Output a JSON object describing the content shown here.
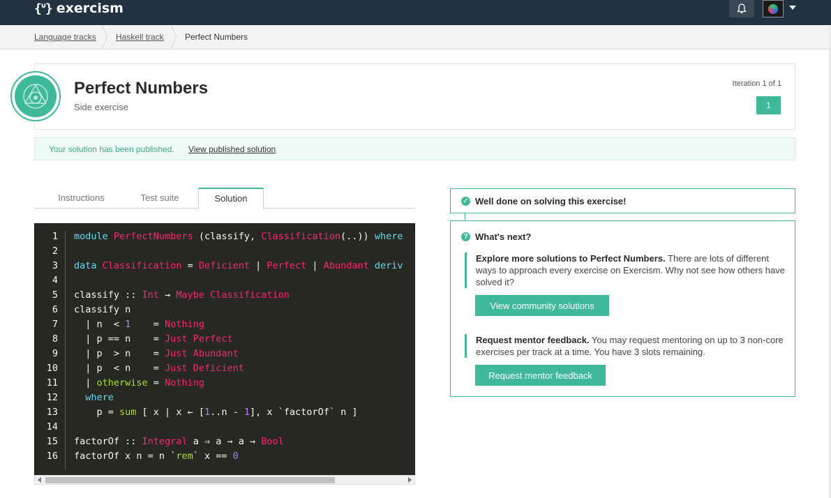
{
  "app": {
    "logo_mark": "{ᐡ}",
    "logo_text": "exercism"
  },
  "breadcrumb": [
    {
      "label": "Language tracks",
      "link": true
    },
    {
      "label": "Haskell track",
      "link": true
    },
    {
      "label": "Perfect Numbers",
      "link": false
    }
  ],
  "exercise": {
    "title": "Perfect Numbers",
    "subtitle": "Side exercise",
    "iteration_label": "Iteration 1 of 1",
    "iteration_button": "1"
  },
  "notice": {
    "text": "Your solution has been published.",
    "link": "View published solution"
  },
  "tabs": [
    {
      "label": "Instructions",
      "active": false
    },
    {
      "label": "Test suite",
      "active": false
    },
    {
      "label": "Solution",
      "active": true
    }
  ],
  "code": {
    "lines": [
      [
        [
          "k",
          "module"
        ],
        [
          "",
          ""
        ],
        [
          "t",
          "PerfectNumbers"
        ],
        [
          "",
          " (classify, "
        ],
        [
          "t",
          "Classification"
        ],
        [
          "",
          "(..)) "
        ],
        [
          "k",
          "where"
        ]
      ],
      [],
      [
        [
          "k",
          "data"
        ],
        [
          "",
          " "
        ],
        [
          "t",
          "Classification"
        ],
        [
          "",
          " = "
        ],
        [
          "t",
          "Deficient"
        ],
        [
          "",
          " | "
        ],
        [
          "t",
          "Perfect"
        ],
        [
          "",
          " | "
        ],
        [
          "t",
          "Abundant"
        ],
        [
          "",
          " "
        ],
        [
          "k",
          "deriv"
        ]
      ],
      [],
      [
        [
          "",
          "classify :: "
        ],
        [
          "t",
          "Int"
        ],
        [
          "",
          " → "
        ],
        [
          "t",
          "Maybe Classification"
        ]
      ],
      [
        [
          "",
          "classify n"
        ]
      ],
      [
        [
          "",
          "  | n  < "
        ],
        [
          "n",
          "1"
        ],
        [
          "",
          "    = "
        ],
        [
          "t",
          "Nothing"
        ]
      ],
      [
        [
          "",
          "  | p == n    = "
        ],
        [
          "t",
          "Just Perfect"
        ]
      ],
      [
        [
          "",
          "  | p  > n    = "
        ],
        [
          "t",
          "Just Abundant"
        ]
      ],
      [
        [
          "",
          "  | p  < n    = "
        ],
        [
          "t",
          "Just Deficient"
        ]
      ],
      [
        [
          "",
          "  | "
        ],
        [
          "g",
          "otherwise"
        ],
        [
          "",
          " = "
        ],
        [
          "t",
          "Nothing"
        ]
      ],
      [
        [
          "k",
          "  where"
        ]
      ],
      [
        [
          "",
          "    p = "
        ],
        [
          "g",
          "sum"
        ],
        [
          "",
          " [ x | x ← ["
        ],
        [
          "n",
          "1"
        ],
        [
          "",
          "..n - "
        ],
        [
          "n",
          "1"
        ],
        [
          "",
          "], x `factorOf` n ]"
        ]
      ],
      [],
      [
        [
          "",
          "factorOf :: "
        ],
        [
          "t",
          "Integral"
        ],
        [
          "",
          " a ⇒ a → a → "
        ],
        [
          "t",
          "Bool"
        ]
      ],
      [
        [
          "",
          "factorOf x n = n `"
        ],
        [
          "g",
          "rem"
        ],
        [
          "",
          "` x == "
        ],
        [
          "n",
          "0"
        ]
      ]
    ],
    "line_numbers": [
      "1",
      "2",
      "3",
      "4",
      "5",
      "6",
      "7",
      "8",
      "9",
      "10",
      "11",
      "12",
      "13",
      "14",
      "15",
      "16"
    ]
  },
  "right_panel": {
    "done_title": "Well done on solving this exercise!",
    "next_title": "What's next?",
    "explore_bold": "Explore more solutions to Perfect Numbers.",
    "explore_text": " There are lots of different ways to approach every exercise on Exercism. Why not see how others have solved it?",
    "community_button": "View community solutions",
    "mentor_bold": "Request mentor feedback.",
    "mentor_text": " You may request mentoring on up to 3 non-core exercises per track at a time. You have 3 slots remaining.",
    "mentor_button": "Request mentor feedback"
  },
  "colors": {
    "accent": "#3fb999",
    "topbar": "#233240",
    "code_bg": "#272822"
  },
  "icons": [
    "bell-icon",
    "avatar-icon",
    "chevron-down-icon",
    "check-circle-icon",
    "question-circle-icon",
    "exercise-icon"
  ]
}
